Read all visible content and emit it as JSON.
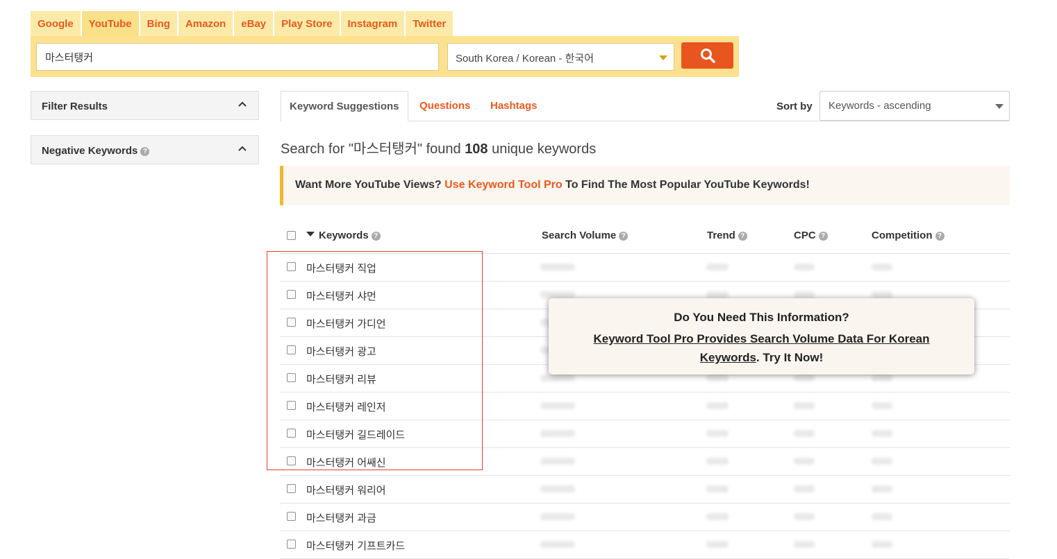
{
  "platform_tabs": {
    "items": [
      {
        "label": "Google"
      },
      {
        "label": "YouTube"
      },
      {
        "label": "Bing"
      },
      {
        "label": "Amazon"
      },
      {
        "label": "eBay"
      },
      {
        "label": "Play Store"
      },
      {
        "label": "Instagram"
      },
      {
        "label": "Twitter"
      }
    ],
    "active": "YouTube"
  },
  "search": {
    "query": "마스터탱커",
    "language": "South Korea / Korean - 한국어",
    "button_icon": "search-icon"
  },
  "sidebar": {
    "filter_title": "Filter Results",
    "negative_title": "Negative Keywords"
  },
  "content_tabs": {
    "suggestions": "Keyword Suggestions",
    "questions": "Questions",
    "hashtags": "Hashtags"
  },
  "sort": {
    "label": "Sort by",
    "value": "Keywords - ascending"
  },
  "result": {
    "prefix": "Search for \"마스터탱커\" found ",
    "count": "108",
    "suffix": " unique keywords"
  },
  "promo": {
    "lead": "Want More YouTube Views?",
    "link": "Use Keyword Tool Pro",
    "tail": "To Find The Most Popular YouTube Keywords!"
  },
  "table": {
    "columns": {
      "keywords": "Keywords",
      "search_volume": "Search Volume",
      "trend": "Trend",
      "cpc": "CPC",
      "competition": "Competition"
    },
    "rows": [
      {
        "keyword_base": "마스터탱커",
        "keyword_extra": "직업"
      },
      {
        "keyword_base": "마스터탱커",
        "keyword_extra": "샤먼"
      },
      {
        "keyword_base": "마스터탱커",
        "keyword_extra": "가디언"
      },
      {
        "keyword_base": "마스터탱커",
        "keyword_extra": "광고"
      },
      {
        "keyword_base": "마스터탱커",
        "keyword_extra": "리뷰"
      },
      {
        "keyword_base": "마스터탱커",
        "keyword_extra": "레인저"
      },
      {
        "keyword_base": "마스터탱커",
        "keyword_extra": "길드레이드"
      },
      {
        "keyword_base": "마스터탱커",
        "keyword_extra": "어쌔신"
      },
      {
        "keyword_base": "마스터탱커",
        "keyword_extra": "워리어"
      },
      {
        "keyword_base": "마스터탱커",
        "keyword_extra": "과금"
      },
      {
        "keyword_base": "마스터탱커",
        "keyword_extra": "기프트카드"
      }
    ]
  },
  "popup": {
    "title": "Do You Need This Information?",
    "link": "Keyword Tool Pro Provides Search Volume Data For Korean Keywords",
    "tail": ". Try It Now!"
  },
  "colors": {
    "accent_orange": "#e8551e",
    "tab_yellow": "#fdeaa8",
    "search_yellow": "#fce18f",
    "promo_border": "#f1b82d",
    "highlight_red": "#e23b3b"
  }
}
